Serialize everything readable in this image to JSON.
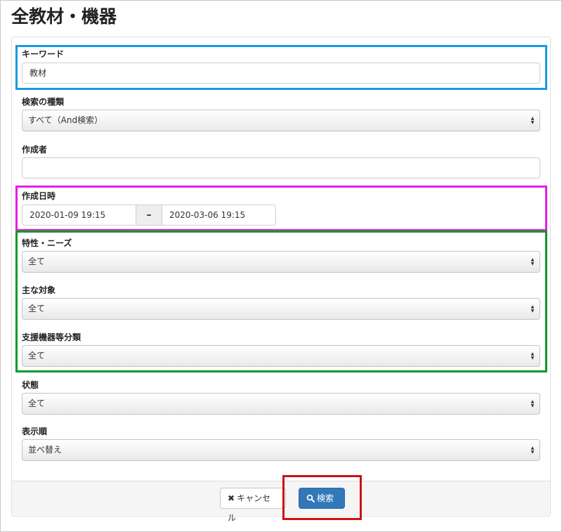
{
  "page": {
    "title": "全教材・機器"
  },
  "form": {
    "keyword": {
      "label": "キーワード",
      "value": "教材"
    },
    "search_type": {
      "label": "検索の種類",
      "value": "すべて（And検索）"
    },
    "author": {
      "label": "作成者",
      "value": ""
    },
    "created_at": {
      "label": "作成日時",
      "from": "2020-01-09 19:15",
      "separator": "–",
      "to": "2020-03-06 19:15"
    },
    "traits": {
      "label": "特性・ニーズ",
      "value": "全て"
    },
    "target": {
      "label": "主な対象",
      "value": "全て"
    },
    "device_category": {
      "label": "支援機器等分類",
      "value": "全て"
    },
    "status": {
      "label": "状態",
      "value": "全て"
    },
    "sort": {
      "label": "表示順",
      "value": "並べ替え"
    }
  },
  "footer": {
    "cancel_label": "キャンセル",
    "search_label": "検索"
  },
  "colors": {
    "highlight_keyword": "#1a9ae0",
    "highlight_date": "#e61ee6",
    "highlight_filters": "#0a9a2a",
    "highlight_search": "#cc1111",
    "primary_button": "#3278b8"
  },
  "icons": {
    "cancel": "times-icon",
    "search": "magnifier-icon",
    "select_arrows": "updown-arrows-icon"
  }
}
